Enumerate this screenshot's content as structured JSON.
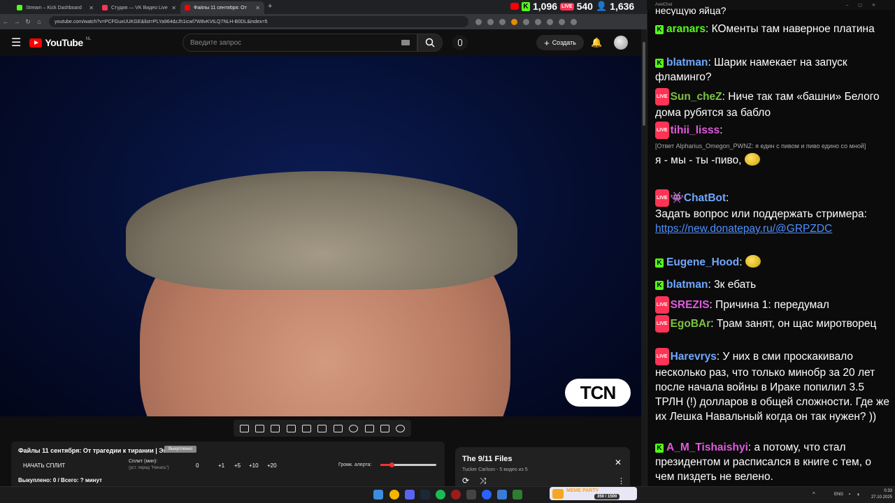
{
  "browser": {
    "tabs": [
      {
        "title": "Stream – Kick Dashboard",
        "color": "#53fc18"
      },
      {
        "title": "Студия — VK Видео Live",
        "color": "#ff3355"
      },
      {
        "title": "Файлы 11 сентября: От тр",
        "color": "#ff0000"
      }
    ],
    "new_tab": "+",
    "url": "youtube.com/watch?v=PCFGuxUUKGE&list=PLYa964dzJh1icwl7W8vKVtLQ7NLH-B0DL&index=5"
  },
  "stream_stats": {
    "kick_viewers": "1,096",
    "vk_viewers": "540",
    "total_viewers": "1,636"
  },
  "youtube": {
    "logo": "YouTube",
    "region": "NL",
    "search_placeholder": "Введите запрос",
    "create_label": "Создать",
    "watermark": "TCN"
  },
  "split_panel": {
    "title": "Файлы 11 сентября: От трагедии к тирании | Эп 5",
    "tag": "Выкупленно",
    "start_button": "НАЧАТЬ СПЛИТ",
    "split_label": "Сплит (мин):",
    "split_hint": "(уст. перед \"Начать\")",
    "split_value": "0",
    "add_buttons": [
      "+1",
      "+5",
      "+10",
      "+20"
    ],
    "volume_label": "Громк. алерта:",
    "volume_level": 0.2,
    "bought_text": "Выкуплено: 0 / Всего: ? минут"
  },
  "playlist": {
    "title": "The 9/11 Files",
    "subtitle": "Tucker Carlson - 5 видео из 5"
  },
  "chat": {
    "window_title": "AxelChat",
    "top_fragment": "несущую яйца?",
    "messages": [
      {
        "platform": "kick",
        "nick": "aranars",
        "color": "#53fc18",
        "text": "КОменты там наверное платина"
      },
      {
        "platform": "kick",
        "nick": "blatman",
        "color": "#6fa8ff",
        "text": "Шарик намекает на запуск фламинго?"
      },
      {
        "platform": "vk",
        "nick": "Sun_cheZ",
        "color": "#7cc242",
        "text": "Ниче так там «башни» Белого дома рубятся за бабло"
      },
      {
        "platform": "vk",
        "nick": "tihii_lisss",
        "color": "#e05adf",
        "reply": "[Ответ Alpharius_Omegon_PWNZ: я един с пивом и пиво едино со мной]",
        "text": "я - мы - ты -пиво,"
      },
      {
        "platform": "vk",
        "nick": "ChatBot",
        "color": "#6fa8ff",
        "text": "Задать вопрос или поддержать стримера:",
        "link": "https://new.donatepay.ru/@GRPZDC"
      },
      {
        "platform": "kick",
        "nick": "Eugene_Hood",
        "color": "#6fa8ff",
        "text": ""
      },
      {
        "platform": "kick",
        "nick": "blatman",
        "color": "#6fa8ff",
        "text": "3к ебать"
      },
      {
        "platform": "vk",
        "nick": "SREZIS",
        "color": "#e05adf",
        "text": "Причина 1: передумал"
      },
      {
        "platform": "vk",
        "nick": "EgoBAr",
        "color": "#7cc242",
        "text": "Трам занят, он щас миротворец"
      },
      {
        "platform": "vk",
        "nick": "Harevrys",
        "color": "#6fa8ff",
        "text": "У них в сми проскакивало несколько раз, что только минобр за 20 лет после начала войны в Ираке попилил 3.5 ТРЛН (!) долларов в общей сложности. Где же их Лешка Навальный когда он так нужен? ))"
      },
      {
        "platform": "kick",
        "nick": "A_M_Tishaishyi",
        "color": "#e05adf",
        "text": "а потому, что стал президентом и расписался в книге с тем, о чем пиздеть не велено."
      }
    ]
  },
  "taskbar": {
    "meme_party": "МЕМЕ PARTY",
    "meme_counter": "350 / 1500",
    "lang": "ENG",
    "time": "0:33",
    "date": "27.10.2025"
  }
}
